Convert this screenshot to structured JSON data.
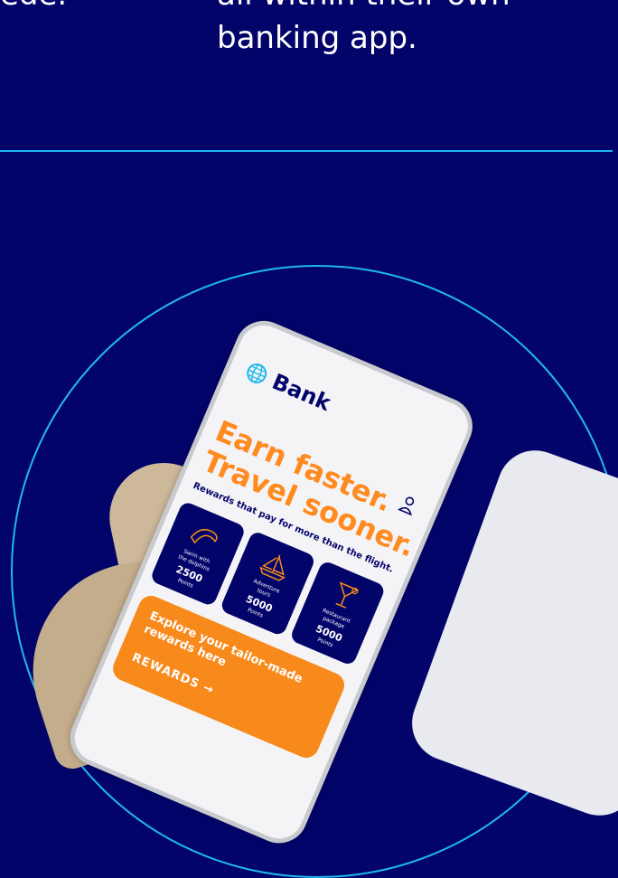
{
  "hero": {
    "left_text": "ede.",
    "right_text_line1": "all within their own",
    "right_text_line2": "banking app."
  },
  "phone": {
    "logo_text": "Bank",
    "headline_line1": "Earn faster.",
    "headline_line2": "Travel sooner.",
    "tagline": "Rewards that pay for more than the flight.",
    "cards": [
      {
        "label_line1": "Swim with",
        "label_line2": "the dolphins",
        "points": "2500",
        "unit": "Points",
        "icon": "dolphin-icon"
      },
      {
        "label_line1": "Adventure",
        "label_line2": "tours",
        "points": "5000",
        "unit": "Points",
        "icon": "sailboat-icon"
      },
      {
        "label_line1": "Restaurant",
        "label_line2": "package",
        "points": "5000",
        "unit": "Points",
        "icon": "cocktail-icon"
      }
    ],
    "promo_line1": "Explore your tailor-made",
    "promo_line2": "rewards here",
    "promo_cta": "REWARDS →"
  },
  "colors": {
    "background": "#03046a",
    "accent_line": "#1ab4f0",
    "orange": "#f88a1c",
    "navy": "#03046a"
  }
}
